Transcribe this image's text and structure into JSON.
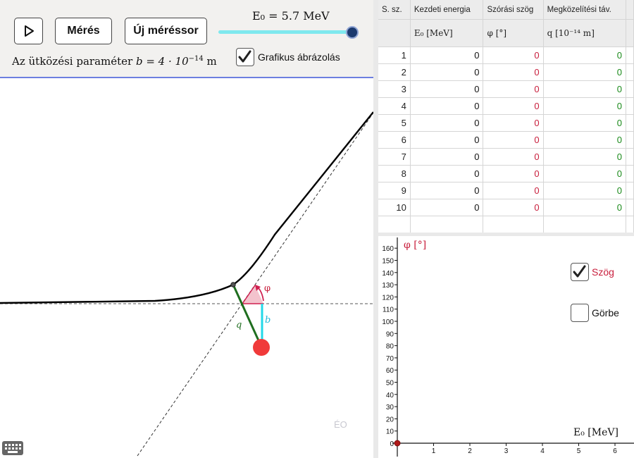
{
  "toolbar": {
    "play_icon": "play-icon",
    "measure_label": "Mérés",
    "new_series_label": "Új méréssor",
    "energy_text": "E₀ = 5.7 MeV",
    "energy_value": 5.7,
    "energy_slider_fraction": 0.97,
    "graph_checkbox_label": "Grafikus ábrázolás",
    "graph_checkbox_checked": true,
    "impact_text_prefix": "Az ütközési paraméter ",
    "impact_text_formula": "b = 4 · 10",
    "impact_text_exp": "−14",
    "impact_text_unit": " m"
  },
  "scene": {
    "phi_label": "φ",
    "q_label": "q",
    "b_label": "b",
    "watermark": "ÉO",
    "colors": {
      "trajectory": "#000000",
      "q_line": "#1f6e1f",
      "b_line": "#22d8e8",
      "nucleus": "#f03a3a",
      "angle": "#d02050"
    }
  },
  "table": {
    "col_headers": [
      "S. sz.",
      "Kezdeti energia",
      "Szórási szög",
      "Megközelítési táv."
    ],
    "unit_headers": [
      "",
      "E₀ [MeV]",
      "φ [°]",
      "q [10⁻¹⁴ m]"
    ],
    "rows": [
      {
        "n": "1",
        "e": "0",
        "phi": "0",
        "q": "0"
      },
      {
        "n": "2",
        "e": "0",
        "phi": "0",
        "q": "0"
      },
      {
        "n": "3",
        "e": "0",
        "phi": "0",
        "q": "0"
      },
      {
        "n": "4",
        "e": "0",
        "phi": "0",
        "q": "0"
      },
      {
        "n": "5",
        "e": "0",
        "phi": "0",
        "q": "0"
      },
      {
        "n": "6",
        "e": "0",
        "phi": "0",
        "q": "0"
      },
      {
        "n": "7",
        "e": "0",
        "phi": "0",
        "q": "0"
      },
      {
        "n": "8",
        "e": "0",
        "phi": "0",
        "q": "0"
      },
      {
        "n": "9",
        "e": "0",
        "phi": "0",
        "q": "0"
      },
      {
        "n": "10",
        "e": "0",
        "phi": "0",
        "q": "0"
      }
    ]
  },
  "graph": {
    "y_axis_label": "φ [°]",
    "x_axis_label": "E₀ [MeV]",
    "y_ticks": [
      0,
      10,
      20,
      30,
      40,
      50,
      60,
      70,
      80,
      90,
      100,
      110,
      120,
      130,
      140,
      150,
      160
    ],
    "x_ticks": [
      1,
      2,
      3,
      4,
      5,
      6
    ],
    "point": {
      "x": 0,
      "y": 0
    },
    "szog_label": "Szög",
    "szog_checked": true,
    "gorbe_label": "Görbe",
    "gorbe_checked": false
  }
}
